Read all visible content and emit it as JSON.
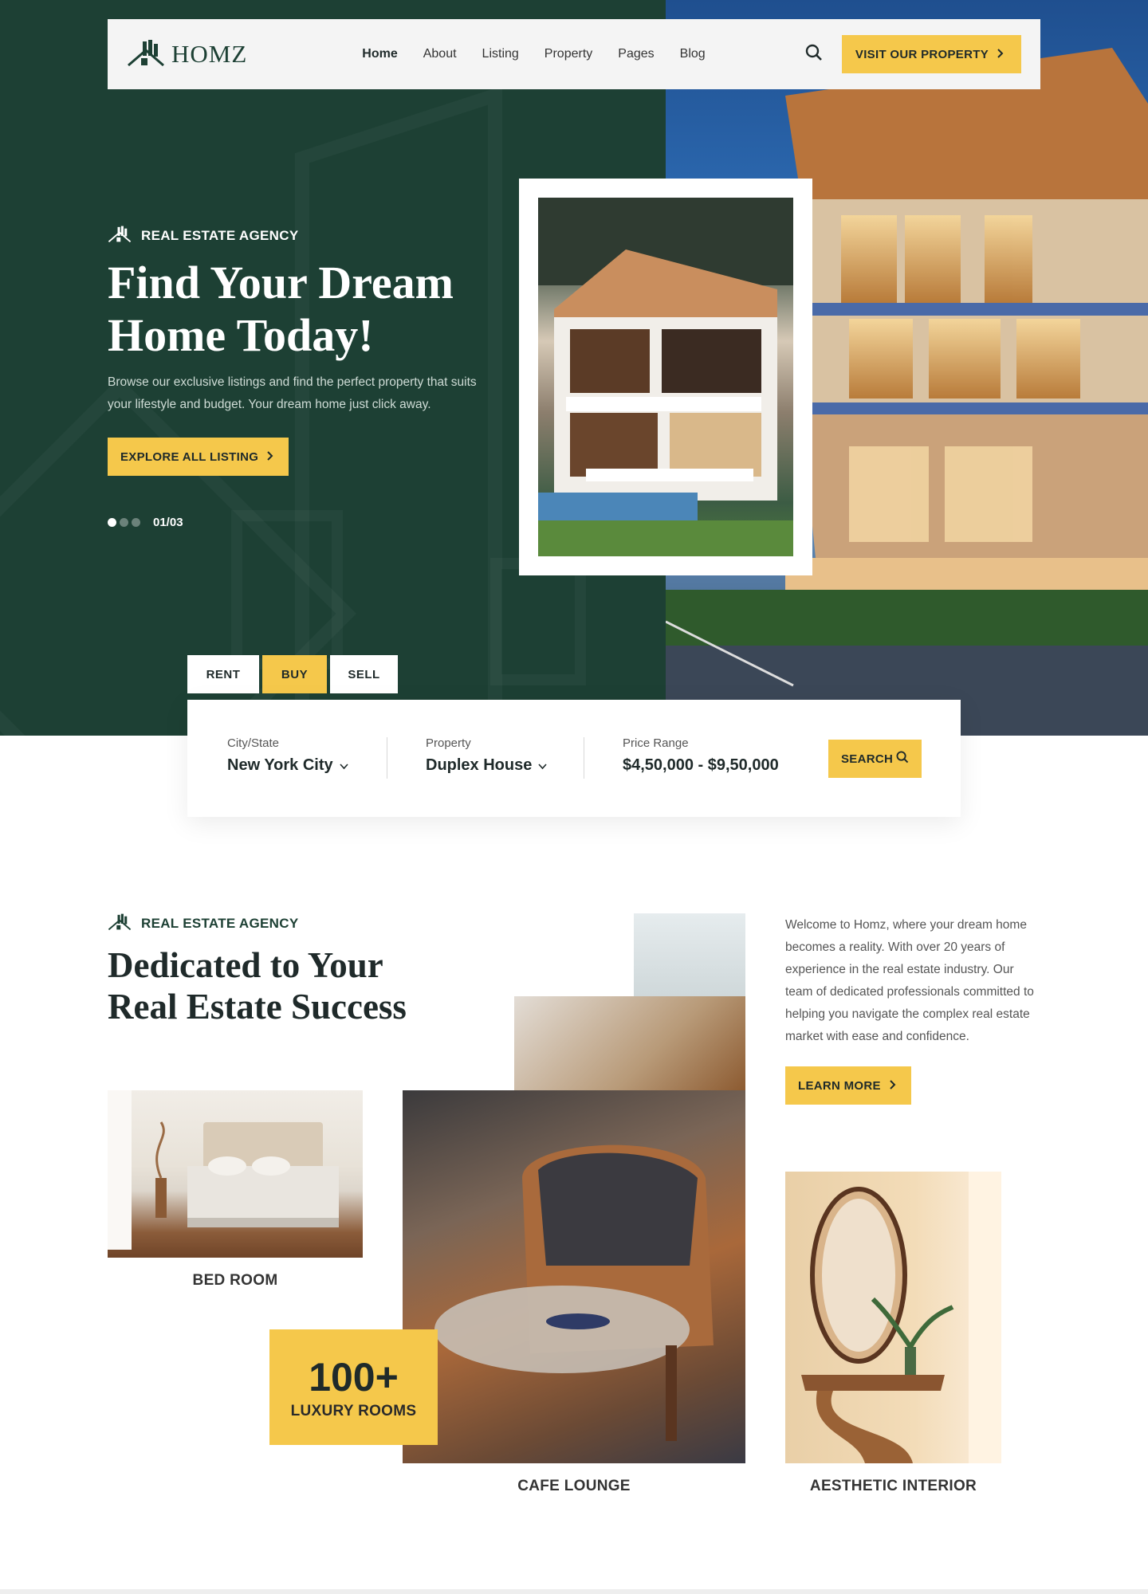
{
  "brand": {
    "name": "HOMZ"
  },
  "nav": {
    "links": [
      "Home",
      "About",
      "Listing",
      "Property",
      "Pages",
      "Blog"
    ],
    "active": "Home",
    "cta_label": "VISIT OUR PROPERTY"
  },
  "hero": {
    "eyebrow": "REAL ESTATE AGENCY",
    "title": "Find Your Dream Home Today!",
    "description": "Browse our exclusive listings and find the perfect property that suits your lifestyle and budget. Your dream home just click away.",
    "button_label": "EXPLORE ALL LISTING",
    "slide_counter": "01/03",
    "slide_total": 3,
    "slide_active": 1
  },
  "search": {
    "tabs": [
      "RENT",
      "BUY",
      "SELL"
    ],
    "active_tab": "BUY",
    "city_label": "City/State",
    "city_value": "New York City",
    "property_label": "Property",
    "property_value": "Duplex House",
    "price_label": "Price Range",
    "price_value": "$4,50,000 - $9,50,000",
    "button_label": "SEARCH"
  },
  "about": {
    "eyebrow": "REAL ESTATE AGENCY",
    "title": "Dedicated to Your Real Estate Success",
    "description": "Welcome to Homz, where your dream home becomes a reality. With over 20 years of experience in the real estate industry. Our team of dedicated professionals committed to helping you navigate the complex real estate market with ease and confidence.",
    "button_label": "LEARN MORE",
    "captions": {
      "bed": "BED ROOM",
      "cafe": "CAFE LOUNGE",
      "interior": "AESTHETIC INTERIOR"
    },
    "stat": {
      "value": "100+",
      "label": "LUXURY ROOMS"
    }
  },
  "colors": {
    "green": "#1d4034",
    "yellow": "#f5c84b",
    "white": "#ffffff"
  },
  "icons": [
    "house-logo-icon",
    "search-icon",
    "chevron-right-icon",
    "chevron-down-icon"
  ]
}
